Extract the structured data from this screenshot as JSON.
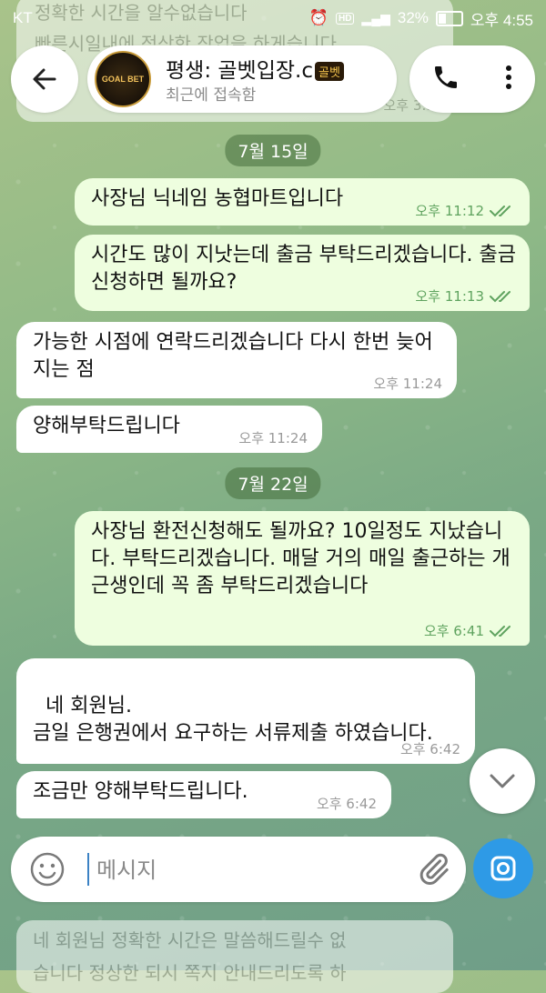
{
  "status_bar": {
    "carrier": "KT",
    "battery": "32%",
    "time": "오후 4:55"
  },
  "background_messages": {
    "top_line1": "정확한 시간을 알수없습니다",
    "top_line2": "빠른시일내에 정상한 작업을 하게습니다",
    "top_time": "오후 3:5",
    "bottom_line1": "네 회원님 정확한 시간은 말씀해드릴수 없",
    "bottom_line2": "습니다 정상한 되시 쪽지 안내드리도록 하"
  },
  "header": {
    "avatar_text": "GOAL BET",
    "title": "평생: 골벳입장.c",
    "badge": "골벳",
    "status": "최근에 접속함"
  },
  "dates": {
    "d1": "7월 15일",
    "d2": "7월 22일"
  },
  "messages": [
    {
      "text": "사장님 닉네임 농협마트입니다",
      "time": "오후 11:12"
    },
    {
      "text": "시간도 많이 지낫는데 출금 부탁드리겠습니다. 출금신청하면 될까요?",
      "time": "오후 11:13"
    },
    {
      "text": "가능한 시점에 연락드리겠습니다 다시 한번 늦어지는 점",
      "time": "오후 11:24"
    },
    {
      "text": "양해부탁드립니다",
      "time": "오후 11:24"
    },
    {
      "text": "사장님 환전신청해도 될까요? 10일정도 지났습니다. 부탁드리겠습니다.  매달 거의 매일 출근하는 개근생인데 꼭 좀 부탁드리겠습니다",
      "time": "오후 6:41"
    },
    {
      "text": "네 회원님.\n금일 은행권에서 요구하는 서류제출 하였습니다.",
      "time": "오후 6:42"
    },
    {
      "text": "조금만 양해부탁드립니다.",
      "time": "오후 6:42"
    }
  ],
  "composer": {
    "placeholder": "메시지"
  },
  "colors": {
    "outgoing": "#eefedf",
    "incoming": "#ffffff",
    "accent": "#2e9ae6"
  }
}
